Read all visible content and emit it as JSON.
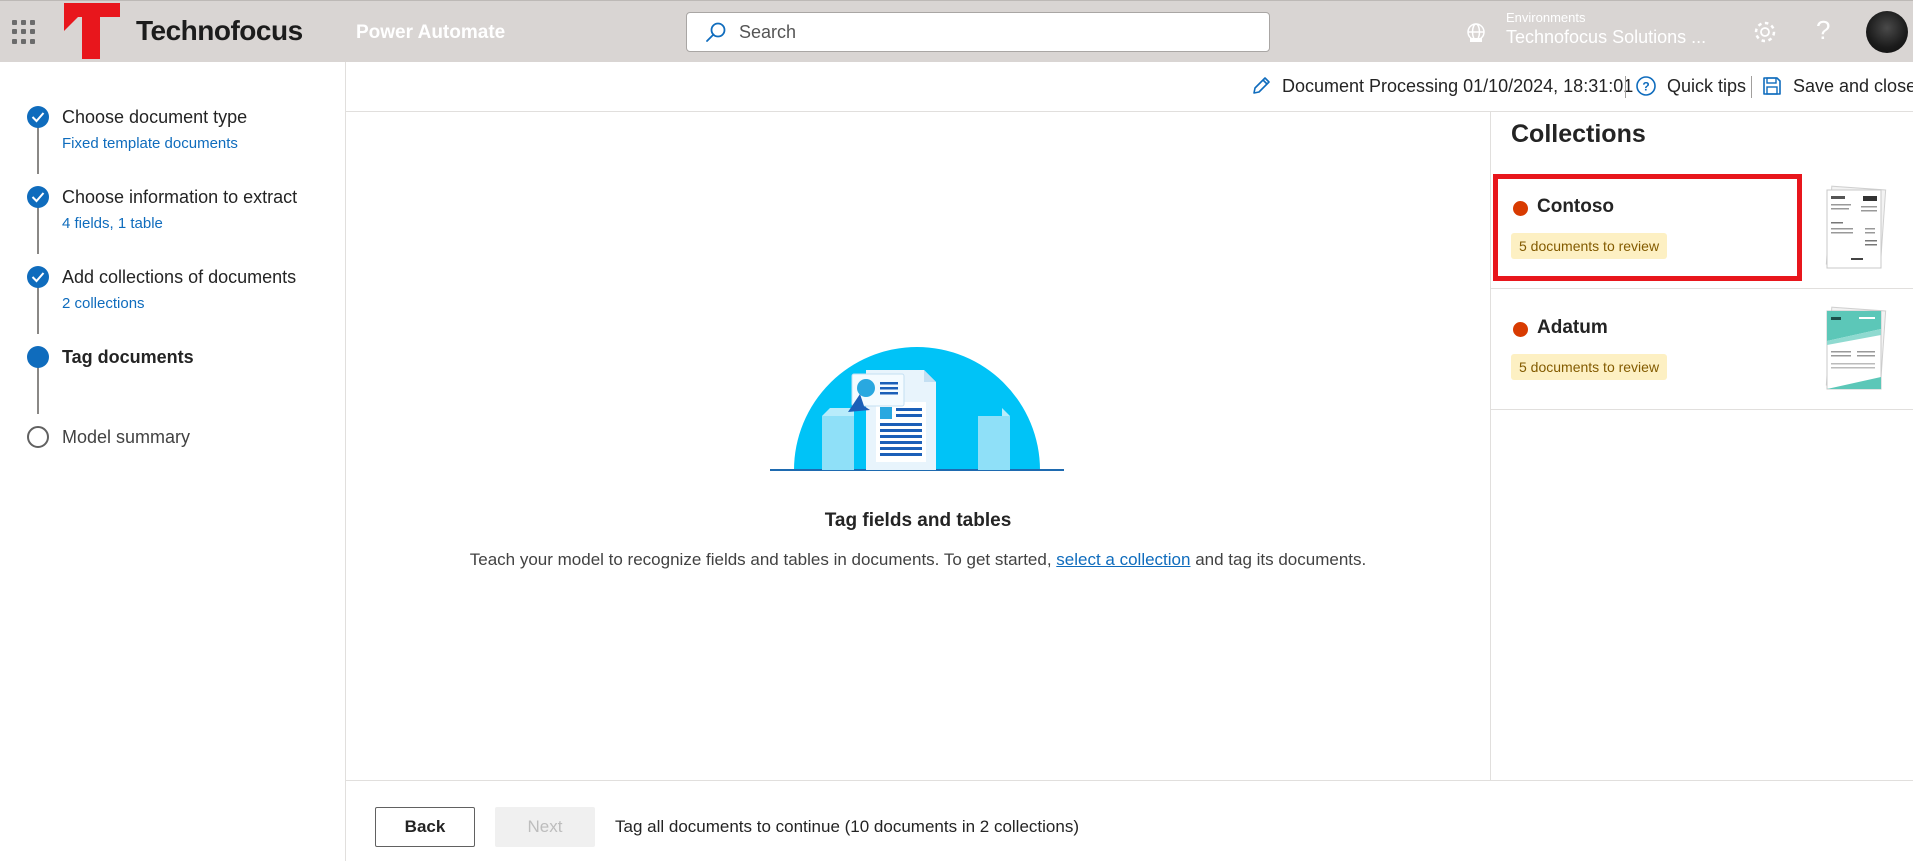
{
  "topbar": {
    "brand": "Technofocus",
    "product": "Power Automate",
    "search_placeholder": "Search",
    "environment_label": "Environments",
    "environment_name": "Technofocus Solutions ...",
    "help_glyph": "?",
    "brand_color": "#e8161c"
  },
  "steps": [
    {
      "title": "Choose document type",
      "subtitle": "Fixed template documents",
      "state": "done"
    },
    {
      "title": "Choose information to extract",
      "subtitle": "4 fields, 1 table",
      "state": "done"
    },
    {
      "title": "Add collections of documents",
      "subtitle": "2 collections",
      "state": "done"
    },
    {
      "title": "Tag documents",
      "subtitle": "",
      "state": "current"
    },
    {
      "title": "Model summary",
      "subtitle": "",
      "state": "todo"
    }
  ],
  "command_bar": {
    "model_name": "Document Processing 01/10/2024, 18:31:01",
    "quick_tips": "Quick tips",
    "save_close": "Save and close"
  },
  "main": {
    "title": "Tag fields and tables",
    "text_before": "Teach your model to recognize fields and tables in documents. To get started, ",
    "link_text": "select a collection",
    "text_after": " and tag its documents."
  },
  "collections_panel": {
    "title": "Collections",
    "items": [
      {
        "name": "Contoso",
        "badge": "5 documents to review",
        "status_color": "#d83b01"
      },
      {
        "name": "Adatum",
        "badge": "5 documents to review",
        "status_color": "#d83b01"
      }
    ]
  },
  "footer": {
    "back_label": "Back",
    "next_label": "Next",
    "status_text": "Tag all documents to continue (10 documents in 2 collections)"
  },
  "icons": [
    "waffle-icon",
    "search-icon",
    "environment-icon",
    "gear-icon",
    "help-icon",
    "edit-icon",
    "quick-tips-icon",
    "save-icon",
    "checkmark-icon"
  ]
}
